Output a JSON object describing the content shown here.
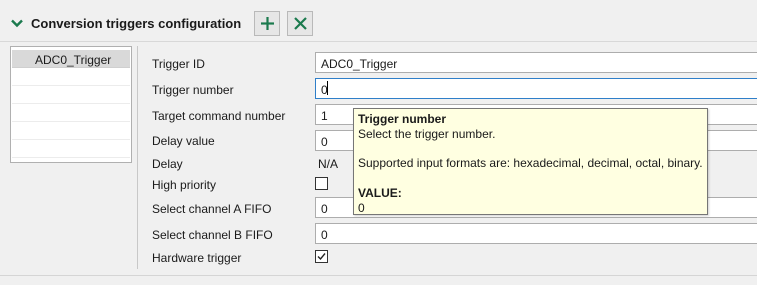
{
  "header": {
    "title": "Conversion triggers configuration",
    "collapse_icon": "chevron-down-icon",
    "add_icon": "plus-icon",
    "remove_icon": "close-icon",
    "accent_color": "#1b7a4e"
  },
  "list": {
    "items": [
      "ADC0_Trigger"
    ],
    "selected": "ADC0_Trigger"
  },
  "form": {
    "trigger_id": {
      "label": "Trigger ID",
      "value": "ADC0_Trigger"
    },
    "trigger_number": {
      "label": "Trigger number",
      "value": "0"
    },
    "target_command_number": {
      "label": "Target command number",
      "value": "1"
    },
    "delay_value": {
      "label": "Delay value",
      "value": "0"
    },
    "delay": {
      "label": "Delay",
      "value": "N/A"
    },
    "high_priority": {
      "label": "High priority",
      "checked": false
    },
    "select_channel_a_fifo": {
      "label": "Select channel A FIFO",
      "value": "0"
    },
    "select_channel_b_fifo": {
      "label": "Select channel B FIFO",
      "value": "0"
    },
    "hardware_trigger": {
      "label": "Hardware trigger",
      "checked": true
    }
  },
  "tooltip": {
    "title": "Trigger number",
    "description": "Select the trigger number.",
    "formats": "Supported input formats are: hexadecimal, decimal, octal, binary.",
    "value_label": "VALUE:",
    "value": "0"
  }
}
